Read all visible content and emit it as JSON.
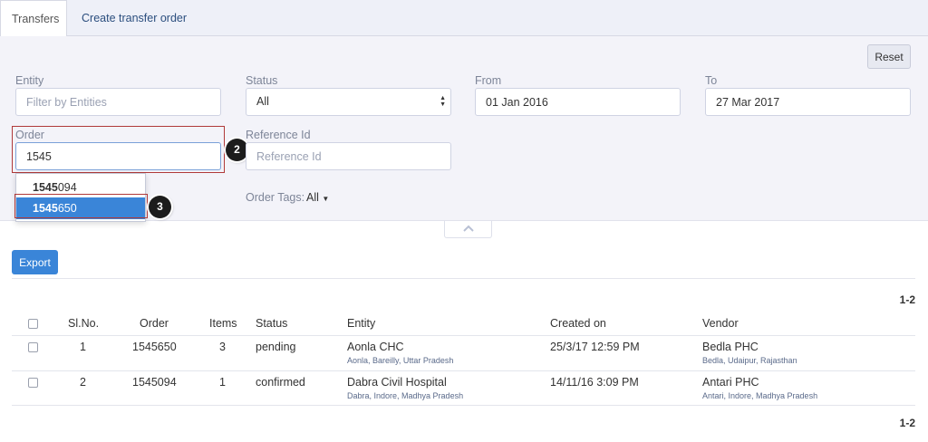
{
  "tabs": [
    {
      "label": "Transfers",
      "active": true
    },
    {
      "label": "Create transfer order",
      "active": false
    }
  ],
  "filters": {
    "reset_label": "Reset",
    "entity": {
      "label": "Entity",
      "placeholder": "Filter by Entities"
    },
    "status": {
      "label": "Status",
      "value": "All"
    },
    "from": {
      "label": "From",
      "value": "01 Jan 2016"
    },
    "to": {
      "label": "To",
      "value": "27 Mar 2017"
    },
    "order": {
      "label": "Order",
      "value": "1545"
    },
    "reference": {
      "label": "Reference Id",
      "placeholder": "Reference Id"
    },
    "order_tags": {
      "label": "Order Tags:",
      "value": "All"
    }
  },
  "suggestions": [
    {
      "match": "1545",
      "rest": "094",
      "selected": false
    },
    {
      "match": "1545",
      "rest": "650",
      "selected": true
    }
  ],
  "annotations": {
    "order_badge": "2",
    "suggestion_badge": "3"
  },
  "actions": {
    "export_label": "Export"
  },
  "pagination": {
    "top": "1-2",
    "bottom": "1-2"
  },
  "table": {
    "headers": [
      "Sl.No.",
      "Order",
      "Items",
      "Status",
      "Entity",
      "Created on",
      "Vendor"
    ],
    "rows": [
      {
        "slno": "1",
        "order": "1545650",
        "items": "3",
        "status": "pending",
        "entity": "Aonla CHC",
        "entity_loc": "Aonla, Bareilly, Uttar Pradesh",
        "created": "25/3/17 12:59 PM",
        "vendor": "Bedla PHC",
        "vendor_loc": "Bedla, Udaipur, Rajasthan"
      },
      {
        "slno": "2",
        "order": "1545094",
        "items": "1",
        "status": "confirmed",
        "entity": "Dabra Civil Hospital",
        "entity_loc": "Dabra, Indore, Madhya Pradesh",
        "created": "14/11/16 3:09 PM",
        "vendor": "Antari PHC",
        "vendor_loc": "Antari, Indore, Madhya Pradesh"
      }
    ]
  },
  "colors": {
    "accent": "#3a85d8",
    "annotation_border": "#b03a3a",
    "tab_link": "#2b4e7e"
  }
}
